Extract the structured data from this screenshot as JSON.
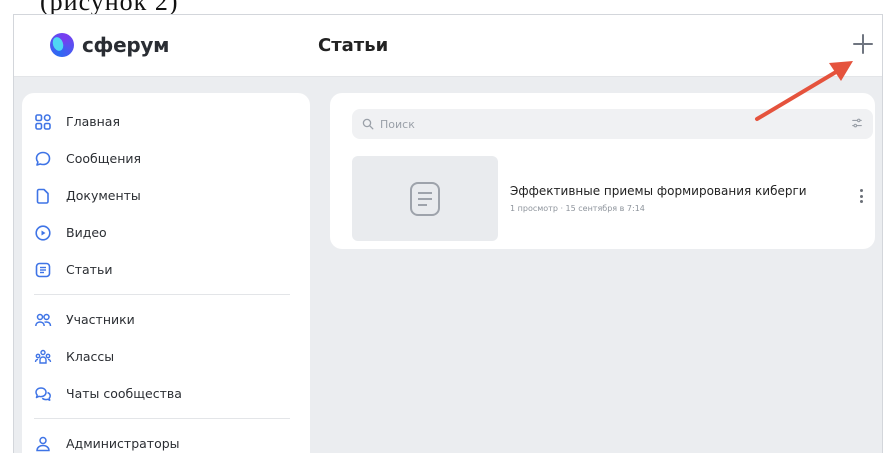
{
  "header": {
    "logo_text": "сферум",
    "page_title": "Статьи"
  },
  "sidebar": {
    "items": [
      {
        "label": "Главная",
        "icon": "grid-icon"
      },
      {
        "label": "Сообщения",
        "icon": "message-bubble-icon"
      },
      {
        "label": "Документы",
        "icon": "document-icon"
      },
      {
        "label": "Видео",
        "icon": "video-play-icon"
      },
      {
        "label": "Статьи",
        "icon": "article-icon"
      },
      {
        "label": "Участники",
        "icon": "members-icon"
      },
      {
        "label": "Классы",
        "icon": "classes-icon"
      },
      {
        "label": "Чаты сообщества",
        "icon": "community-chats-icon"
      },
      {
        "label": "Администраторы",
        "icon": "admin-user-icon"
      }
    ]
  },
  "search": {
    "placeholder": "Поиск"
  },
  "articles": [
    {
      "title": "Эффективные приемы формирования киберги",
      "meta": "1 просмотр · 15 сентября в 7:14"
    }
  ],
  "colors": {
    "accent": "#2c6bf2",
    "arrow": "#e5533d",
    "background": "#ebedf0"
  }
}
